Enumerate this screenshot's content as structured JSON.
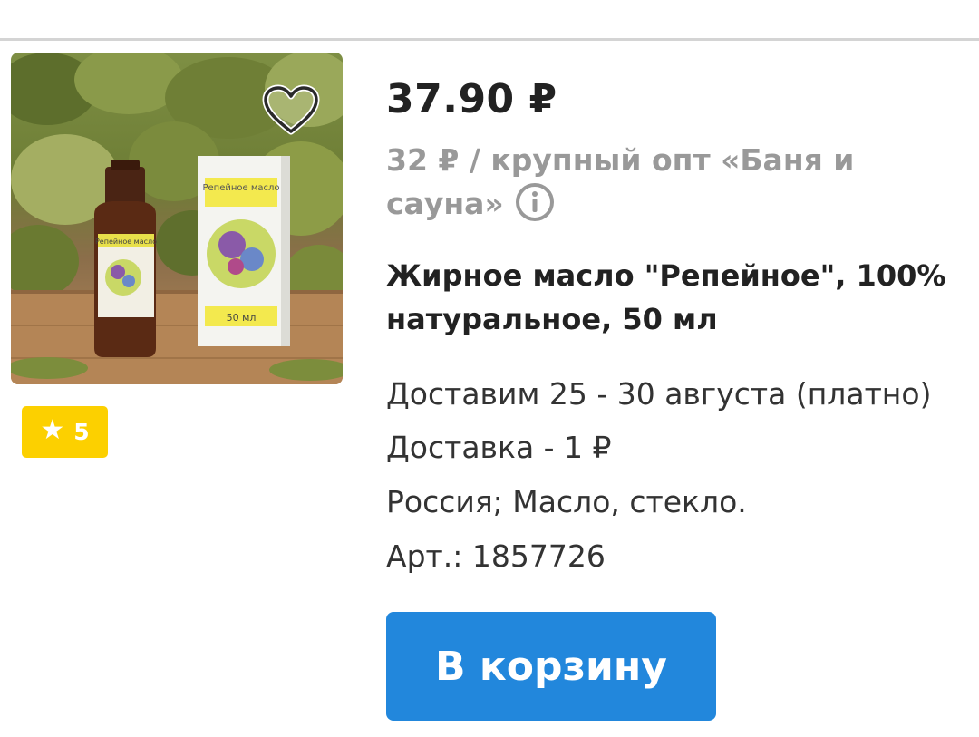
{
  "product": {
    "image_alt": "Жирное масло \"Репейное\" bottle and box",
    "image_labels": {
      "box_name": "Репейное масло",
      "bottle_name": "Репейное масло",
      "volume": "50 мл"
    },
    "rating": "5",
    "price": "37.90 ₽",
    "wholesale_text": "32 ₽ / крупный опт «Баня и сауна»",
    "title": "Жирное масло \"Репейное\", 100% натуральное, 50 мл",
    "delivery_date": "Доставим 25 - 30 августа (платно)",
    "delivery_cost": "Доставка - 1 ₽",
    "origin": "Россия; Масло, стекло.",
    "article": "Арт.: 1857726",
    "cart_label": "В корзину"
  },
  "icons": {
    "favorite": "heart-icon",
    "rating": "star-icon",
    "info": "info-icon"
  },
  "colors": {
    "cart_button": "#2287dc",
    "rating_badge": "#fcd000",
    "muted_text": "#999999",
    "primary_text": "#222222"
  }
}
